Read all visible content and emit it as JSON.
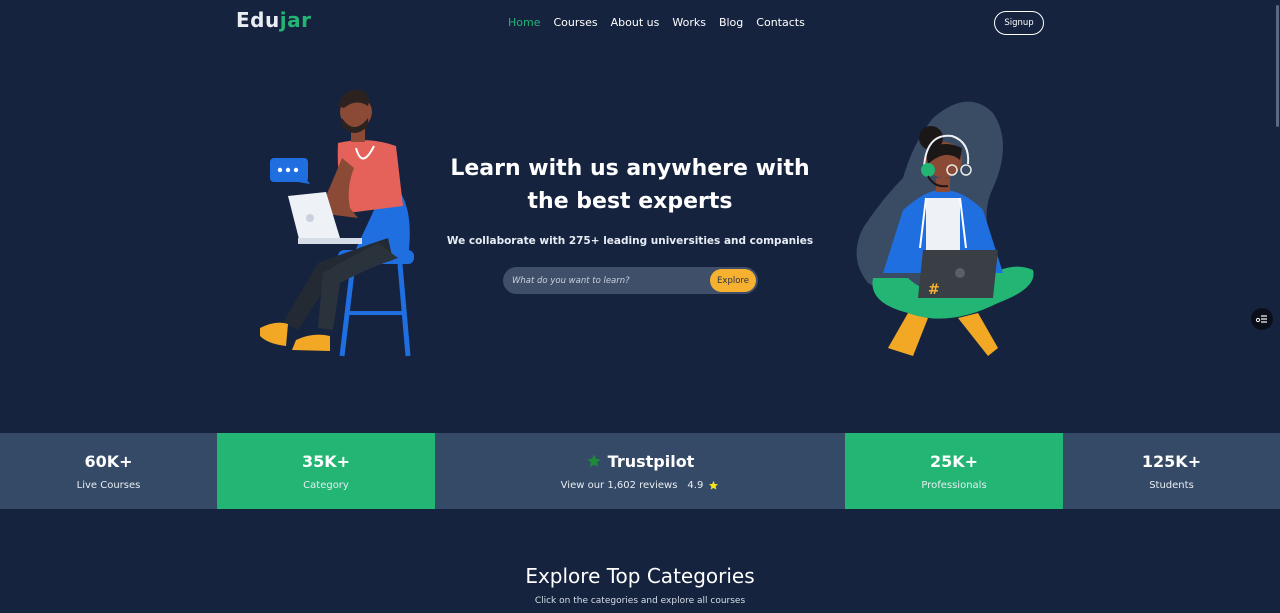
{
  "brand": {
    "part1": "Edu",
    "part2": "jar"
  },
  "nav": {
    "items": [
      {
        "label": "Home",
        "active": true
      },
      {
        "label": "Courses",
        "active": false
      },
      {
        "label": "About us",
        "active": false
      },
      {
        "label": "Works",
        "active": false
      },
      {
        "label": "Blog",
        "active": false
      },
      {
        "label": "Contacts",
        "active": false
      }
    ],
    "signup_label": "Signup"
  },
  "hero": {
    "title_line1": "Learn with us anywhere with",
    "title_line2": "the best experts",
    "subtitle": "We collaborate with 275+ leading universities and companies",
    "search_placeholder": "What do you want to learn?",
    "explore_label": "Explore"
  },
  "stats": [
    {
      "value": "60K+",
      "label": "Live Courses",
      "style": "dark"
    },
    {
      "value": "35K+",
      "label": "Category",
      "style": "green"
    },
    {
      "value": "25K+",
      "label": "Professionals",
      "style": "green"
    },
    {
      "value": "125K+",
      "label": "Students",
      "style": "dark"
    }
  ],
  "trustpilot": {
    "name": "Trustpilot",
    "reviews_text": "View our 1,602 reviews",
    "rating": "4.9",
    "icon": "star-icon"
  },
  "categories": {
    "title": "Explore Top Categories",
    "subtitle": "Click on the categories and explore all courses"
  },
  "colors": {
    "background": "#15233f",
    "accent_green": "#22b573",
    "accent_yellow": "#f6b130",
    "stat_dark": "#354a66"
  }
}
